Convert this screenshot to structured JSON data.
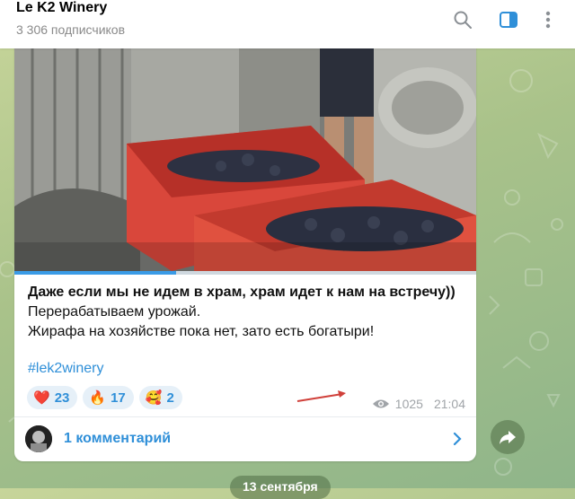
{
  "header": {
    "title": "Le K2 Winery",
    "subscribers": "3 306 подписчиков",
    "icons": [
      "search-icon",
      "sidebar-toggle-icon",
      "more-vertical-icon"
    ]
  },
  "post": {
    "video_progress_percent": 35,
    "lines": {
      "bold": "Даже если мы не идем в храм, храм идет к нам на встречу))",
      "line2": "Перерабатываем урожай.",
      "line3": "Жирафа на хозяйстве пока нет, зато есть богатыри!"
    },
    "hashtag": "#lek2winery",
    "reactions": [
      {
        "emoji": "❤️",
        "count": "23",
        "icon": "heart-icon"
      },
      {
        "emoji": "🔥",
        "count": "17",
        "icon": "fire-icon"
      },
      {
        "emoji": "🥰",
        "count": "2",
        "icon": "smiling-hearts-icon"
      }
    ],
    "views": "1025",
    "time": "21:04",
    "comments_label": "1 комментарий"
  },
  "date_separator": "13 сентября",
  "colors": {
    "accent": "#2f8fd8",
    "header_icon_active": "#2f8fd8",
    "arrow": "#d0403a"
  }
}
